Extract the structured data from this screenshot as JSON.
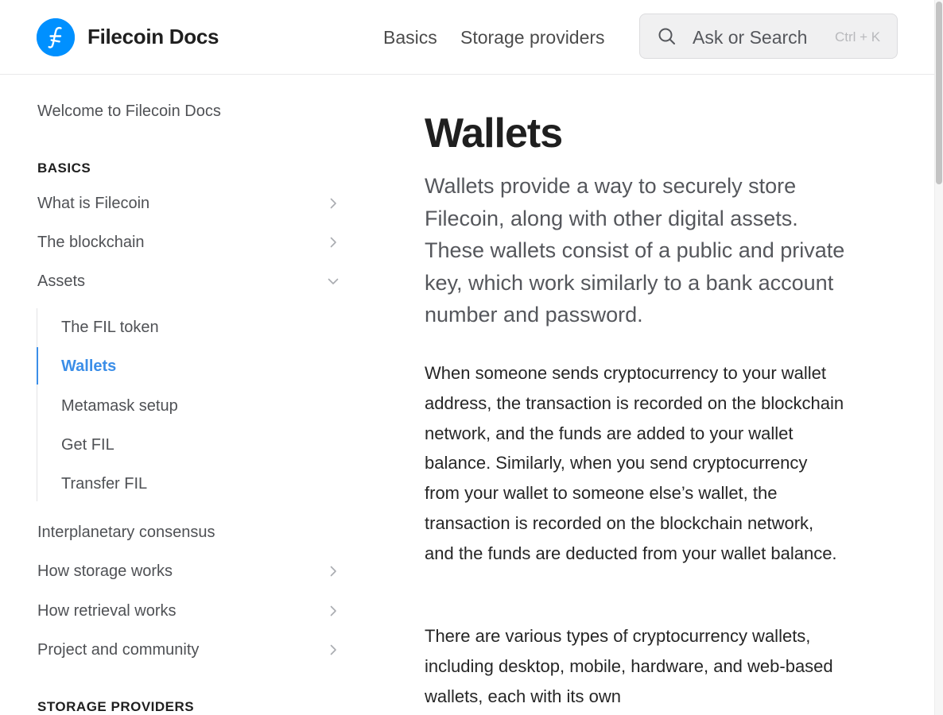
{
  "header": {
    "brand": "Filecoin Docs",
    "nav": {
      "basics": "Basics",
      "storage_providers": "Storage providers"
    },
    "search": {
      "placeholder": "Ask or Search",
      "shortcut": "Ctrl + K"
    }
  },
  "sidebar": {
    "welcome": "Welcome to Filecoin Docs",
    "basics_heading": "BASICS",
    "items": {
      "what_is": "What is Filecoin",
      "blockchain": "The blockchain",
      "assets": "Assets",
      "interplanetary": "Interplanetary consensus",
      "storage_works": "How storage works",
      "retrieval_works": "How retrieval works",
      "project_community": "Project and community"
    },
    "assets_children": {
      "fil_token": "The FIL token",
      "wallets": "Wallets",
      "metamask": "Metamask setup",
      "get_fil": "Get FIL",
      "transfer_fil": "Transfer FIL"
    },
    "storage_heading": "STORAGE PROVIDERS"
  },
  "content": {
    "title": "Wallets",
    "lead": "Wallets provide a way to securely store Filecoin, along with other digital assets. These wallets consist of a public and private key, which work similarly to a bank account number and password.",
    "p1": "When someone sends cryptocurrency to your wallet address, the transaction is recorded on the blockchain network, and the funds are added to your wallet balance. Similarly, when you send cryptocurrency from your wallet to someone else’s wallet, the transaction is recorded on the blockchain network, and the funds are deducted from your wallet balance.",
    "p2": "There are various types of cryptocurrency wallets, including desktop, mobile, hardware, and web-based wallets, each with its own"
  },
  "colors": {
    "accent": "#3b8ee8",
    "logo_bg": "#0090ff",
    "text": "#1f1f1f",
    "muted": "#4f5155"
  },
  "icons": {
    "logo": "filecoin-logo-icon",
    "search": "search-icon",
    "chevron_right": "chevron-right-icon",
    "chevron_down": "chevron-down-icon"
  }
}
